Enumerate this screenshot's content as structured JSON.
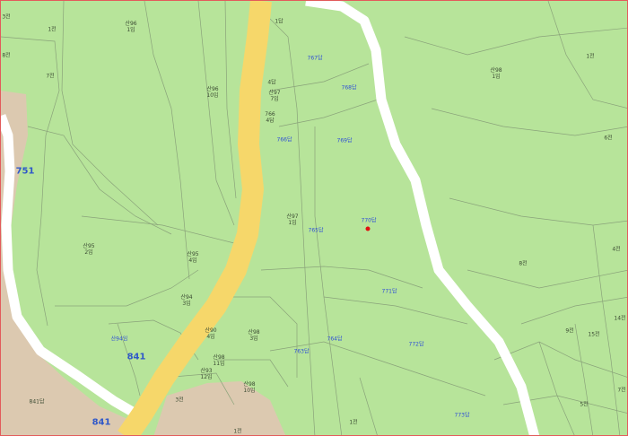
{
  "map": {
    "colors": {
      "forest": "#b7e49a",
      "developed": "#dcc9b0",
      "local_road": "#ffffff",
      "main_road": "#f6d76a",
      "parcel_line": "#8aa37a",
      "label_blue": "#2f4fd6",
      "marker": "#e01010"
    },
    "route_labels": [
      {
        "text": "751",
        "name": "route-751-label"
      },
      {
        "text": "841",
        "name": "route-841-label-upper"
      },
      {
        "text": "841",
        "name": "route-841-label-lower"
      }
    ],
    "lots": [
      {
        "text": "산96\n1임",
        "style": "plain"
      },
      {
        "text": "1전",
        "style": "plain"
      },
      {
        "text": "8전",
        "style": "plain"
      },
      {
        "text": "7전",
        "style": "plain"
      },
      {
        "text": "3전",
        "style": "plain"
      },
      {
        "text": "1답",
        "style": "plain"
      },
      {
        "text": "767답",
        "style": "blue"
      },
      {
        "text": "4답",
        "style": "plain"
      },
      {
        "text": "산96\n10임",
        "style": "plain"
      },
      {
        "text": "산97\n7임",
        "style": "plain"
      },
      {
        "text": "768답",
        "style": "blue"
      },
      {
        "text": "766\n4답",
        "style": "plain"
      },
      {
        "text": "766답",
        "style": "blue"
      },
      {
        "text": "769답",
        "style": "blue"
      },
      {
        "text": "산98\n1임",
        "style": "plain"
      },
      {
        "text": "1전",
        "style": "plain"
      },
      {
        "text": "6전",
        "style": "plain"
      },
      {
        "text": "산97\n1임",
        "style": "plain"
      },
      {
        "text": "765답",
        "style": "blue"
      },
      {
        "text": "770답",
        "style": "blue"
      },
      {
        "text": "산95\n2임",
        "style": "plain"
      },
      {
        "text": "산95\n4임",
        "style": "plain"
      },
      {
        "text": "4전",
        "style": "plain"
      },
      {
        "text": "8전",
        "style": "plain"
      },
      {
        "text": "771답",
        "style": "blue"
      },
      {
        "text": "산94\n3임",
        "style": "plain"
      },
      {
        "text": "산94임",
        "style": "blue"
      },
      {
        "text": "산90\n4임",
        "style": "plain"
      },
      {
        "text": "산98\n3임",
        "style": "plain"
      },
      {
        "text": "764답",
        "style": "blue"
      },
      {
        "text": "763답",
        "style": "blue"
      },
      {
        "text": "772답",
        "style": "blue"
      },
      {
        "text": "9전",
        "style": "plain"
      },
      {
        "text": "15전",
        "style": "plain"
      },
      {
        "text": "14전",
        "style": "plain"
      },
      {
        "text": "산98\n11임",
        "style": "plain"
      },
      {
        "text": "산93\n12임",
        "style": "plain"
      },
      {
        "text": "산98\n10임",
        "style": "plain"
      },
      {
        "text": "3전",
        "style": "plain"
      },
      {
        "text": "7전",
        "style": "plain"
      },
      {
        "text": "5전",
        "style": "plain"
      },
      {
        "text": "841답",
        "style": "plain"
      },
      {
        "text": "773답",
        "style": "blue"
      },
      {
        "text": "1전",
        "style": "plain"
      },
      {
        "text": "1전",
        "style": "plain"
      }
    ]
  }
}
